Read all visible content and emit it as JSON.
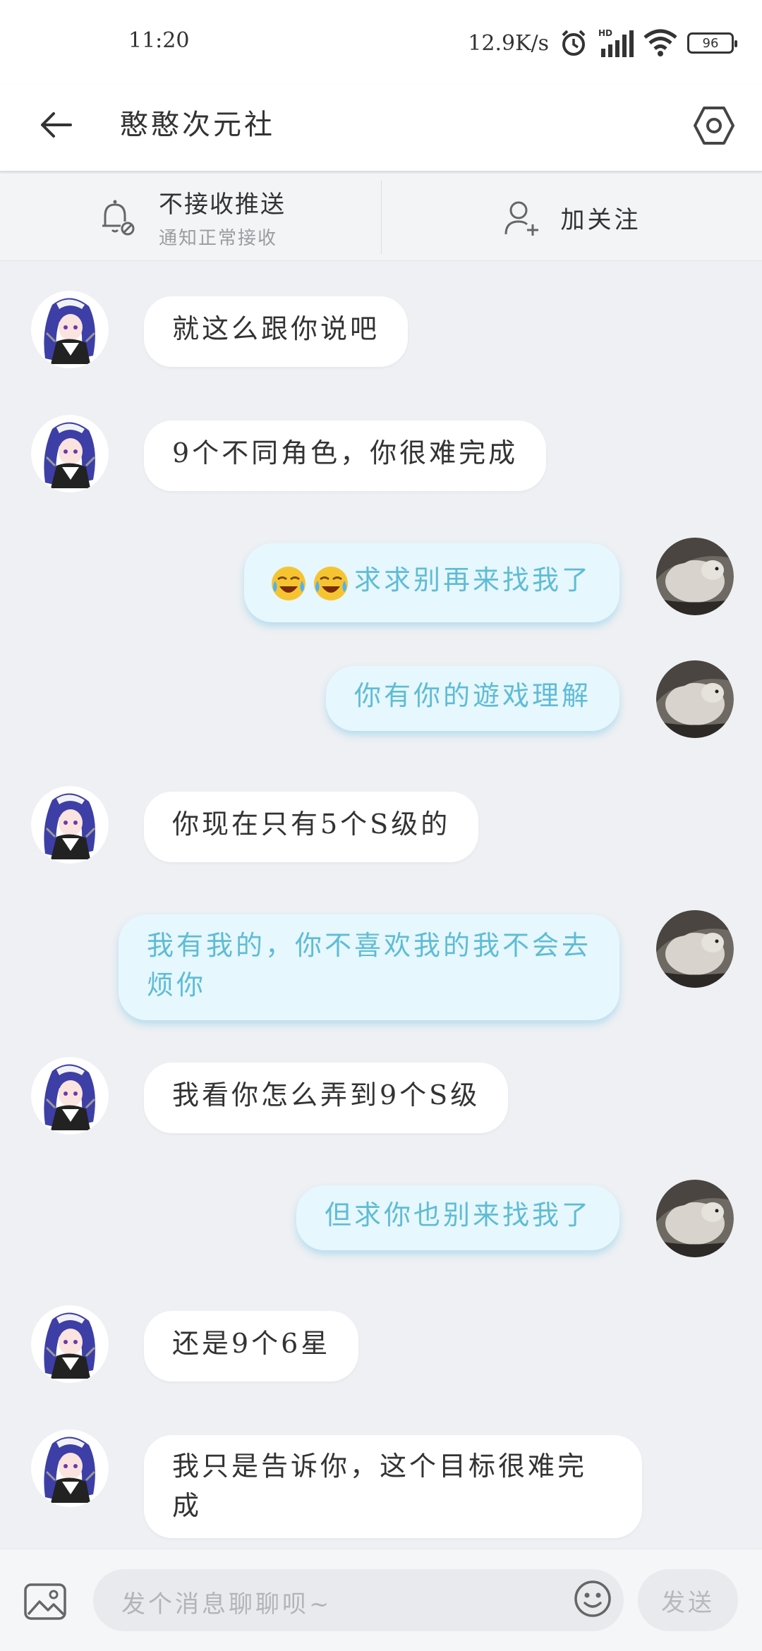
{
  "status_bar": {
    "time": "11:20",
    "network_speed": "12.9K/s",
    "battery": "96",
    "icons": [
      "alarm-icon",
      "hd-signal-icon",
      "wifi-icon",
      "battery-icon"
    ]
  },
  "header": {
    "title": "憨憨次元社",
    "back_icon": "arrow-left-icon",
    "settings_icon": "hexagon-settings-icon"
  },
  "action_bar": {
    "notification_main": "不接收推送",
    "notification_sub": "通知正常接收",
    "follow_label": "加关注"
  },
  "messages": [
    {
      "side": "in",
      "text": "就这么跟你说吧"
    },
    {
      "side": "in",
      "text": "9个不同角色，你很难完成"
    },
    {
      "side": "out",
      "emoji": [
        "laughing-crying-emoji",
        "laughing-crying-emoji"
      ],
      "text": "求求别再来找我了"
    },
    {
      "side": "out",
      "text": "你有你的遊戏理解"
    },
    {
      "side": "in",
      "text": "你现在只有5个S级的"
    },
    {
      "side": "out",
      "text": "我有我的，你不喜欢我的我不会去烦你"
    },
    {
      "side": "in",
      "text": "我看你怎么弄到9个S级"
    },
    {
      "side": "out",
      "text": "但求你也别来找我了"
    },
    {
      "side": "in",
      "text": "还是9个6星"
    },
    {
      "side": "in",
      "text": "我只是告诉你，这个目标很难完成"
    }
  ],
  "input_bar": {
    "placeholder": "发个消息聊聊呗~",
    "send_label": "发送"
  },
  "colors": {
    "outgoing_text": "#5fbcd5",
    "outgoing_bubble": "#e6f7fd",
    "incoming_bubble": "#ffffff",
    "chat_background": "#eef0f3"
  }
}
